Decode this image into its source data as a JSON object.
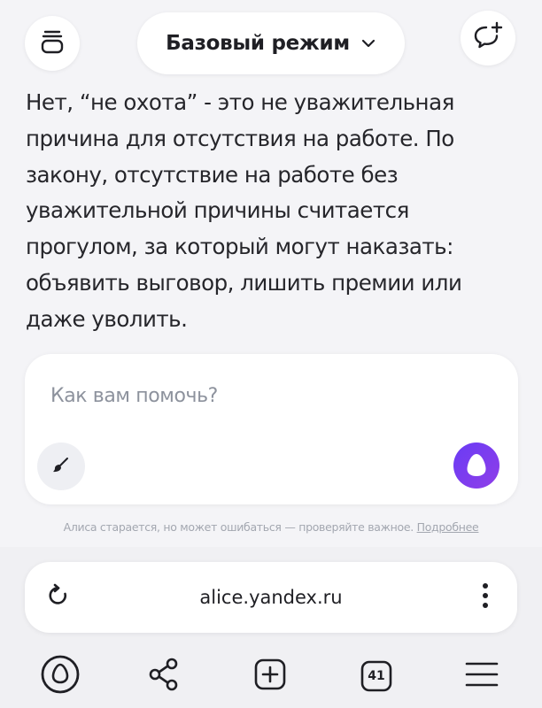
{
  "header": {
    "mode_label": "Базовый режим",
    "icons": {
      "history": "chat-history-icon",
      "mode_dropdown": "chevron-down-icon",
      "new_chat": "new-chat-icon"
    }
  },
  "answer": {
    "text": "Нет, “не охота” - это не уважительная причина для отсутствия на работе. По закону, отсутствие на работе без уважительной причины считается прогулом, за который могут наказать: объявить выговор, лишить премии или даже уволить."
  },
  "composer": {
    "placeholder": "Как вам помочь?",
    "value": "",
    "icons": {
      "brush": "brush-icon",
      "alice": "alice-voice-icon"
    }
  },
  "disclaimer": {
    "text": "Алиса старается, но может ошибаться — проверяйте важное.",
    "link": "Подробнее"
  },
  "browser": {
    "url": "alice.yandex.ru",
    "tabs_count": "41",
    "icons": {
      "reload": "reload-icon",
      "menu": "kebab-menu-icon",
      "alice_home": "alice-home-icon",
      "share": "share-icon",
      "new_tab": "new-tab-icon",
      "tabs": "tabs-icon",
      "hamburger": "hamburger-menu-icon"
    }
  },
  "colors": {
    "background": "#f4f4f7",
    "surface": "#ffffff",
    "text": "#1f1f24",
    "placeholder": "#8d929d",
    "alice_accent": "#7b3ff2"
  }
}
